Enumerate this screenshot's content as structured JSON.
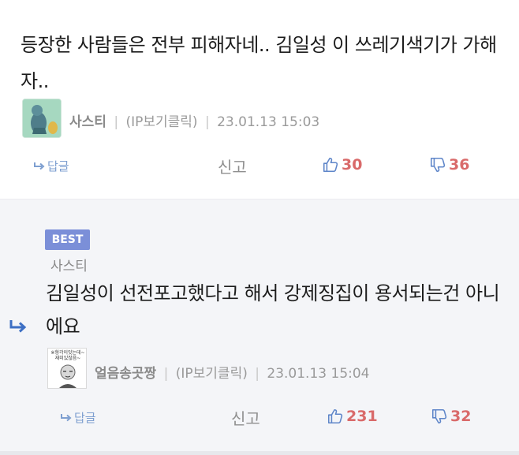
{
  "comment1": {
    "text": "등장한 사람들은 전부 피해자네.. 김일성 이 쓰레기색기가 가해자..",
    "author": "사스티",
    "ip": "(IP보기클릭)",
    "timestamp": "23.01.13 15:03",
    "reply_label": "답글",
    "report_label": "신고",
    "upvotes": "30",
    "downvotes": "36"
  },
  "comment2": {
    "badge": "BEST",
    "reply_to": "사스티",
    "text": "김일성이 선전포고했다고 해서 강제징집이 용서되는건 아니에요",
    "author": "얼음송곳짱",
    "ip": "(IP보기클릭)",
    "timestamp": "23.01.13 15:04",
    "reply_label": "답글",
    "report_label": "신고",
    "upvotes": "231",
    "downvotes": "32",
    "avatar_text": "※형각이잇는데~ 재미있잖음~"
  },
  "colors": {
    "best_badge": "#7b8fd8",
    "upvote": "#5f86c9",
    "downvote": "#e06f6f",
    "reply_link": "#7e9fd0",
    "reply_bg": "#f4f5f8"
  }
}
